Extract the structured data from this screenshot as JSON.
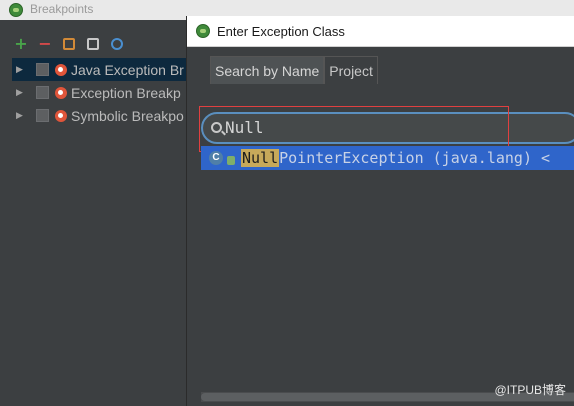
{
  "background_window": {
    "title": "Breakpoints",
    "toolbar": {
      "add_icon": "plus-icon",
      "remove_icon": "minus-icon"
    },
    "tree": [
      {
        "label": "Java Exception Br",
        "selected": true
      },
      {
        "label": "Exception Breakp",
        "selected": false
      },
      {
        "label": "Symbolic Breakpo",
        "selected": false
      }
    ]
  },
  "dialog": {
    "title": "Enter Exception Class",
    "tabs": [
      {
        "label": "Search by Name",
        "active": true
      },
      {
        "label": "Project",
        "active": false
      }
    ],
    "search": {
      "value": "Null"
    },
    "results": [
      {
        "match": "Null",
        "rest": "PointerException (java.lang) <"
      }
    ]
  },
  "watermark": "@ITPUB博客",
  "colors": {
    "selection": "#2f65ca",
    "focus_ring": "#5a8fbf",
    "highlight_box": "#e04040",
    "match_bg": "#c7a95a"
  }
}
